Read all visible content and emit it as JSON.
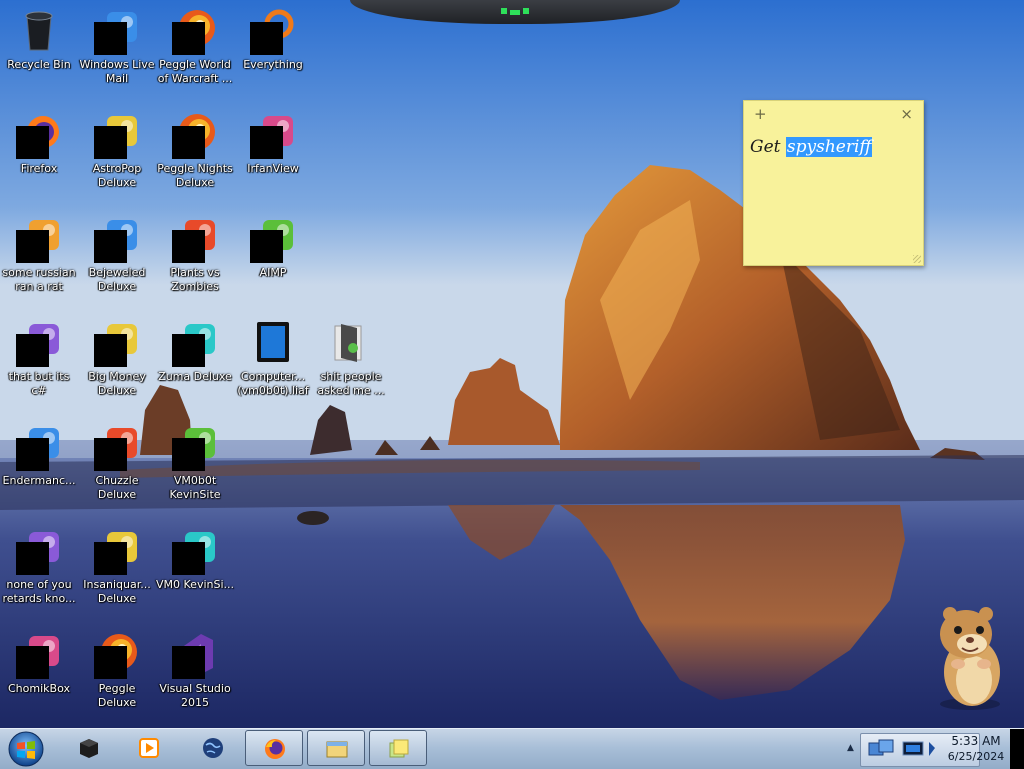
{
  "desktop": {
    "icons": [
      {
        "label": "Recycle Bin",
        "icon": "recycle-bin-icon"
      },
      {
        "label": "Windows Live Mail",
        "icon": "mail-icon"
      },
      {
        "label": "Peggle World of Warcraft ...",
        "icon": "peggle-icon"
      },
      {
        "label": "Everything",
        "icon": "search-icon"
      },
      {
        "label": "Firefox",
        "icon": "firefox-icon"
      },
      {
        "label": "AstroPop Deluxe",
        "icon": "game-icon"
      },
      {
        "label": "Peggle Nights Deluxe",
        "icon": "peggle-icon"
      },
      {
        "label": "IrfanView",
        "icon": "irfanview-icon"
      },
      {
        "label": "some russian ran a rat",
        "icon": "app-icon"
      },
      {
        "label": "Bejeweled Deluxe",
        "icon": "gem-icon"
      },
      {
        "label": "Plants vs Zombies",
        "icon": "plant-icon"
      },
      {
        "label": "AIMP",
        "icon": "music-player-icon"
      },
      {
        "label": "that but its c#",
        "icon": "app-icon"
      },
      {
        "label": "Big Money Deluxe",
        "icon": "money-bag-icon"
      },
      {
        "label": "Zuma Deluxe",
        "icon": "game-icon"
      },
      {
        "label": "Computer... (vm0b0t).liaf",
        "icon": "computer-icon"
      },
      {
        "label": "shit people asked me ...",
        "icon": "folder-icon"
      },
      {
        "label": "Endermanc...",
        "icon": "app-icon"
      },
      {
        "label": "Chuzzle Deluxe",
        "icon": "game-icon"
      },
      {
        "label": "VM0b0t KevinSite",
        "icon": "app-icon"
      },
      {
        "label": "none of you retards kno...",
        "icon": "app-icon"
      },
      {
        "label": "Insaniquar... Deluxe",
        "icon": "game-icon"
      },
      {
        "label": "VM0 KevinSi...",
        "icon": "app-icon"
      },
      {
        "label": "ChomikBox",
        "icon": "chomikbox-icon"
      },
      {
        "label": "Peggle Deluxe",
        "icon": "peggle-icon"
      },
      {
        "label": "Visual Studio 2015",
        "icon": "visual-studio-icon"
      }
    ]
  },
  "sticky_note": {
    "add_glyph": "+",
    "close_glyph": "×",
    "text_prefix": "Get ",
    "selected_text": "spysheriff"
  },
  "taskbar": {
    "start": "windows-start-icon",
    "buttons": [
      {
        "name": "taskbar-blackbox-icon"
      },
      {
        "name": "taskbar-media-player-icon"
      },
      {
        "name": "taskbar-globe-icon"
      },
      {
        "name": "taskbar-firefox-icon"
      },
      {
        "name": "taskbar-explorer-icon"
      },
      {
        "name": "taskbar-sticky-notes-icon"
      }
    ],
    "tray_arrow": "▲",
    "clock_time": "5:33 AM",
    "clock_date": "6/25/2024"
  },
  "colors": {
    "sticky": "#f8f29b",
    "selection": "#3399ff",
    "taskbar": "#a9bfd8"
  }
}
